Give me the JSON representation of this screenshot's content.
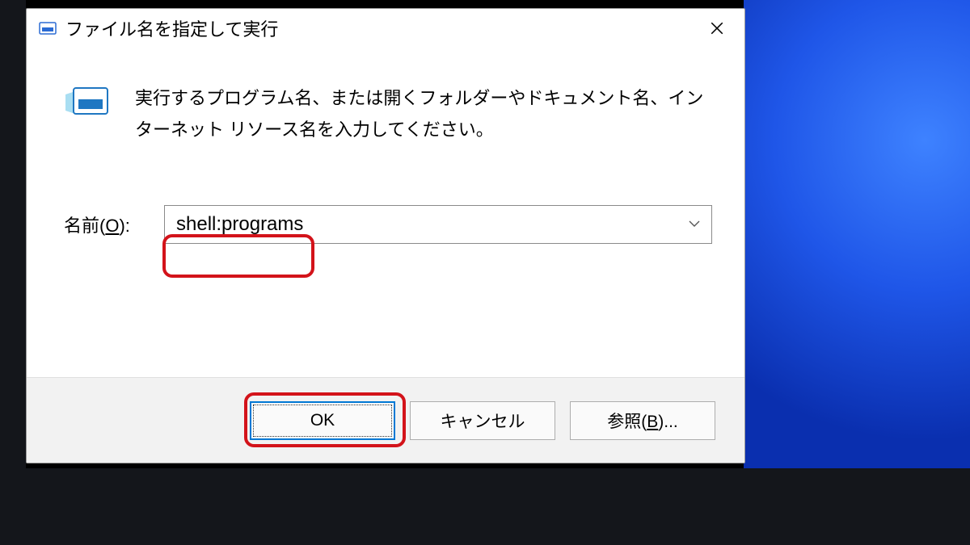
{
  "dialog": {
    "title": "ファイル名を指定して実行",
    "description": "実行するプログラム名、または開くフォルダーやドキュメント名、インターネット リソース名を入力してください。",
    "name_label_prefix": "名前(",
    "name_label_accel": "O",
    "name_label_suffix": "):",
    "input_value": "shell:programs",
    "ok_label": "OK",
    "cancel_label": "キャンセル",
    "browse_prefix": "参照(",
    "browse_accel": "B",
    "browse_suffix": ")..."
  }
}
